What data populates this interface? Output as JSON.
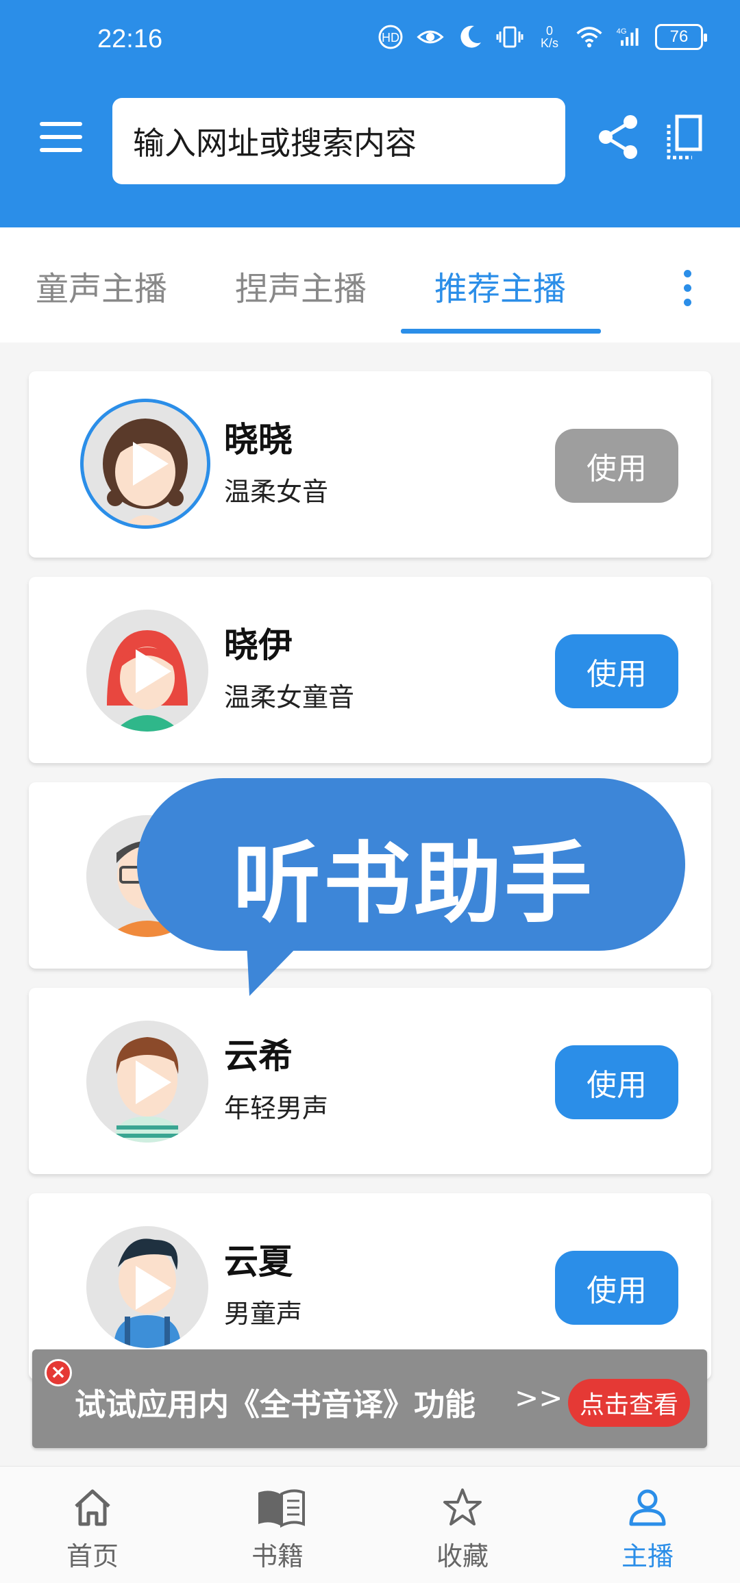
{
  "status_bar": {
    "time": "22:16",
    "net_speed_top": "0",
    "net_speed_bottom": "K/s",
    "battery": "76"
  },
  "header": {
    "search_placeholder": "输入网址或搜索内容"
  },
  "tabs": [
    {
      "label": "童声主播",
      "active": false
    },
    {
      "label": "捏声主播",
      "active": false
    },
    {
      "label": "推荐主播",
      "active": true
    }
  ],
  "voices": [
    {
      "name": "晓晓",
      "desc": "温柔女音",
      "button": "使用",
      "in_use": true
    },
    {
      "name": "晓伊",
      "desc": "温柔女童音",
      "button": "使用",
      "in_use": false
    },
    {
      "name": "",
      "desc": "",
      "button": "",
      "in_use": false
    },
    {
      "name": "云希",
      "desc": "年轻男声",
      "button": "使用",
      "in_use": false
    },
    {
      "name": "云夏",
      "desc": "男童声",
      "button": "使用",
      "in_use": false
    }
  ],
  "overlay": {
    "bubble_text": "听书助手"
  },
  "promo": {
    "text": "试试应用内《全书音译》功能",
    "arrows": ">>",
    "button": "点击查看"
  },
  "bottom_nav": [
    {
      "label": "首页",
      "icon": "home-icon",
      "active": false
    },
    {
      "label": "书籍",
      "icon": "book-icon",
      "active": false
    },
    {
      "label": "收藏",
      "icon": "star-icon",
      "active": false
    },
    {
      "label": "主播",
      "icon": "person-icon",
      "active": true
    }
  ],
  "colors": {
    "primary": "#2b8ee8",
    "disabled": "#9e9e9e",
    "alert": "#e53935",
    "bubble": "#3d86d8"
  }
}
